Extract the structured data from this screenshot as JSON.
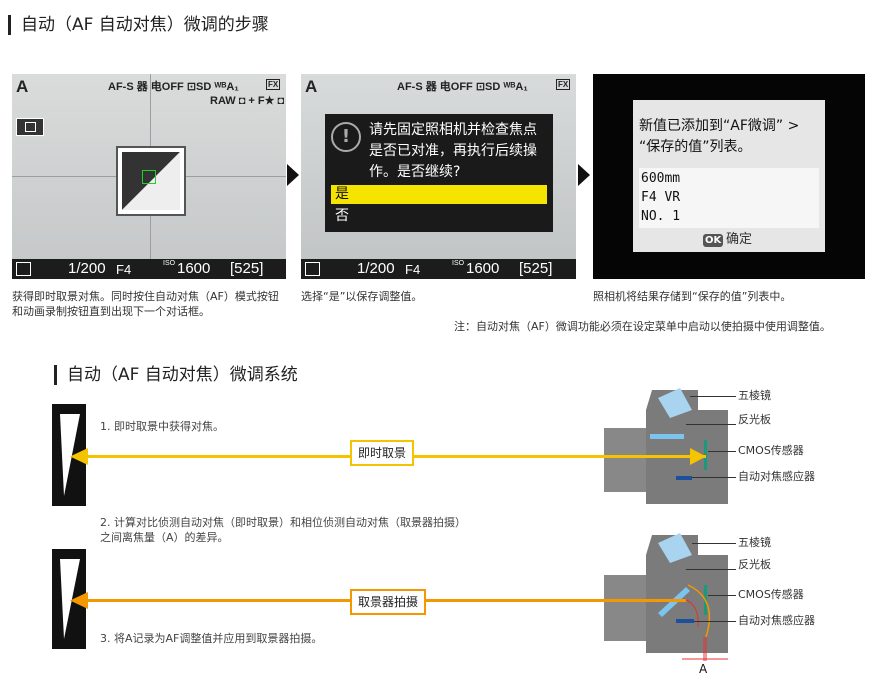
{
  "section1": {
    "title": "自动（AF 自动对焦）微调的步骤"
  },
  "screen1": {
    "mode": "A",
    "status_top": "AF-S 器 电OFF ⊡SD ᵂᴮA₁",
    "fx": "FX",
    "status_top2": "RAW ◘ + F★ ◘",
    "bottom": {
      "shutter": "1/200",
      "aperture": "F4",
      "iso_label": "ISO",
      "iso": "1600",
      "frames": "[525]"
    }
  },
  "screen2": {
    "mode": "A",
    "status_top": "AF-S 器 电OFF ⊡SD ᵂᴮA₁",
    "fx": "FX",
    "dialog_text": "请先固定照相机并检查焦点是否已对准，再执行后续操作。是否继续?",
    "option_yes": "是",
    "option_no": "否",
    "bottom": {
      "shutter": "1/200",
      "aperture": "F4",
      "iso_label": "ISO",
      "iso": "1600",
      "frames": "[525]"
    }
  },
  "screen3": {
    "message": "新值已添加到“AF微调” > “保存的值”列表。",
    "values": [
      "600mm",
      "F4 VR",
      "NO. 1"
    ],
    "ok_label": "OK",
    "confirm": "确定"
  },
  "captions": {
    "step1": "获得即时取景对焦。同时按住自动对焦（AF）模式按钮和动画录制按钮直到出现下一个对话框。",
    "step2": "选择“是”以保存调整值。",
    "step3": "照相机将结果存储到“保存的值”列表中。",
    "note": "注：自动对焦（AF）微调功能必须在设定菜单中启动以使拍摄中使用调整值。"
  },
  "section2": {
    "title": "自动（AF 自动对焦）微调系统"
  },
  "diagram": {
    "step1": "1. 即时取景中获得对焦。",
    "step2_line1": "2. 计算对比侦测自动对焦（即时取景）和相位侦测自动对焦（取景器拍摄）",
    "step2_line2": "之间离焦量（A）的差异。",
    "step3": "3. 将A记录为AF调整值并应用到取景器拍摄。",
    "tag_liveview": "即时取景",
    "tag_viewfinder": "取景器拍摄",
    "labels_top": [
      "五棱镜",
      "反光板",
      "CMOS传感器",
      "自动对焦感应器"
    ],
    "labels_bottom": [
      "五棱镜",
      "反光板",
      "CMOS传感器",
      "自动对焦感应器"
    ],
    "a_label": "A"
  },
  "colors": {
    "yellow": "#f5c400",
    "orange": "#f39800",
    "arrow_dark": "#111111"
  }
}
